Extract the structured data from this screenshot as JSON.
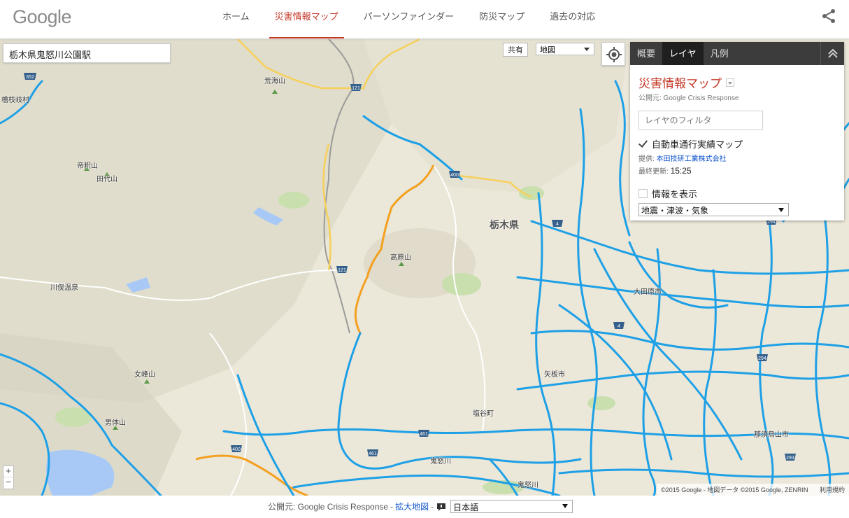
{
  "header": {
    "logo": "Google",
    "nav": [
      "ホーム",
      "災害情報マップ",
      "パーソンファインダー",
      "防災マップ",
      "過去の対応"
    ],
    "active_index": 1
  },
  "map": {
    "search_value": "栃木県鬼怒川公園駅",
    "share_button": "共有",
    "map_type": "地図",
    "zoom_in": "+",
    "zoom_out": "−",
    "attribution": "©2015 Google - 地図データ ©2015 Google, ZENRIN",
    "terms": "利用規約",
    "places": {
      "arami": "荒海山",
      "hinoemata": "檜枝岐村",
      "teishaku": "帝釈山",
      "tashiro": "田代山",
      "tochigi": "栃木県",
      "takahara": "高原山",
      "kawamata": "川俣温泉",
      "nyoho": "女峰山",
      "nantai": "男体山",
      "shiotani": "塩谷町",
      "yaita": "矢板市",
      "ootawara": "大田原市",
      "nasukarasuyama": "那須烏山市",
      "kinu": "鬼怒川",
      "kinu2": "鬼怒川"
    },
    "route_shields": [
      "352",
      "121",
      "121",
      "400",
      "400",
      "461",
      "461",
      "4",
      "4",
      "294",
      "294",
      "293"
    ]
  },
  "panel": {
    "tabs": [
      "概要",
      "レイヤ",
      "凡例"
    ],
    "active_tab": 1,
    "title": "災害情報マップ",
    "publisher": "公開元: Google Crisis Response",
    "filter_placeholder": "レイヤのフィルタ",
    "layer1": {
      "label": "自動車通行実績マップ",
      "checked": true,
      "provider_label": "提供:",
      "provider": "本田技研工業株式会社",
      "updated_label": "最終更新:",
      "updated": "15:25"
    },
    "layer2": {
      "label": "情報を表示",
      "checked": false,
      "select": "地震・津波・気象"
    }
  },
  "footer": {
    "publisher": "公開元: Google Crisis Response",
    "sep": "-",
    "enlarge": "拡大地図",
    "sep2": "-",
    "language": "日本語"
  },
  "colors": {
    "accent": "#c53929",
    "route_blue": "#1ea0e6",
    "route_orange": "#f4a020",
    "link": "#1155cc"
  }
}
